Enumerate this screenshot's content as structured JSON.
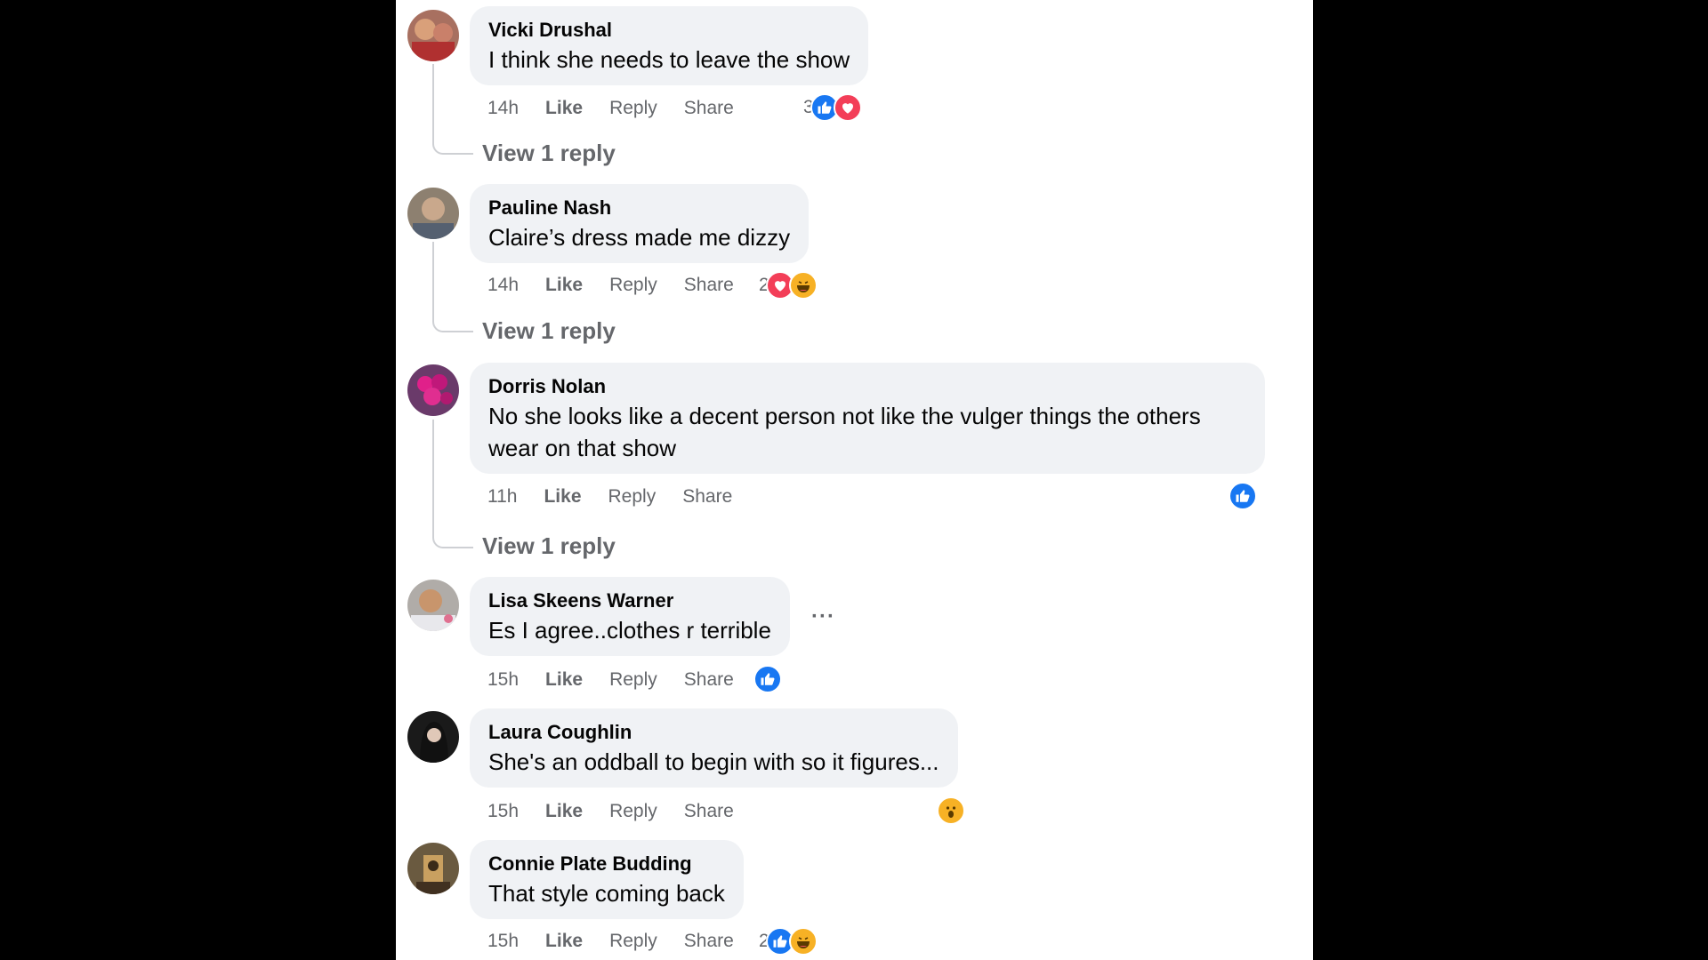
{
  "comments": [
    {
      "author": "Vicki Drushal",
      "text": "I think she needs to leave the show",
      "time": "14h",
      "reaction_count": "3",
      "reactions": [
        "like-icon",
        "love-icon"
      ],
      "view_replies": "View 1 reply"
    },
    {
      "author": "Pauline Nash",
      "text": "Claire’s dress made me dizzy",
      "time": "14h",
      "reaction_count": "2",
      "reactions": [
        "love-icon",
        "haha-icon"
      ],
      "view_replies": "View 1 reply"
    },
    {
      "author": "Dorris Nolan",
      "text": "No she looks like a decent person not like the vulger things the others wear on that show",
      "time": "11h",
      "reaction_count": "",
      "reactions": [
        "like-icon"
      ],
      "view_replies": "View 1 reply"
    },
    {
      "author": "Lisa Skeens Warner",
      "text": "Es I agree..clothes r terrible",
      "time": "15h",
      "reaction_count": "",
      "reactions": [
        "like-icon"
      ],
      "more": "···"
    },
    {
      "author": "Laura Coughlin",
      "text": "She's an oddball to begin with so it figures...",
      "time": "15h",
      "reaction_count": "",
      "reactions": [
        "wow-icon"
      ]
    },
    {
      "author": "Connie Plate Budding",
      "text": "That style coming back",
      "time": "15h",
      "reaction_count": "2",
      "reactions": [
        "like-icon",
        "haha-icon"
      ]
    }
  ],
  "actions": {
    "like": "Like",
    "reply": "Reply",
    "share": "Share"
  },
  "colors": {
    "like": "#1877f2",
    "love": "#f33e58",
    "haha": "#f7b125",
    "text_secondary": "#65676b",
    "bubble": "#f0f2f5"
  }
}
